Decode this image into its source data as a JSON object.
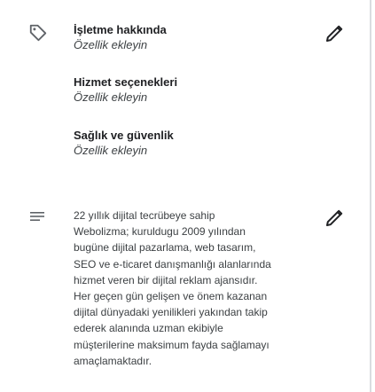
{
  "attributes": {
    "groups": [
      {
        "title": "İşletme hakkında",
        "value": "Özellik ekleyin"
      },
      {
        "title": "Hizmet seçenekleri",
        "value": "Özellik ekleyin"
      },
      {
        "title": "Sağlık ve güvenlik",
        "value": "Özellik ekleyin"
      }
    ],
    "leading_icon": "tag-icon",
    "edit_icon": "pencil-icon"
  },
  "description": {
    "leading_icon": "notes-icon",
    "edit_icon": "pencil-icon",
    "text": "22 yıllık dijital tecrübeye sahip\nWebolizma; kuruldugu 2009 yılından\nbugüne dijital pazarlama, web tasarım,\nSEO ve e-ticaret danışmanlığı alanlarında\nhizmet veren bir dijital reklam ajansıdır.\nHer geçen gün gelişen ve önem kazanan\ndijital dünyadaki yenilikleri yakından takip\nederek alanında uzman ekibiyle\nmüşterilerine maksimum fayda sağlamayı\namaçlamaktadır."
  }
}
